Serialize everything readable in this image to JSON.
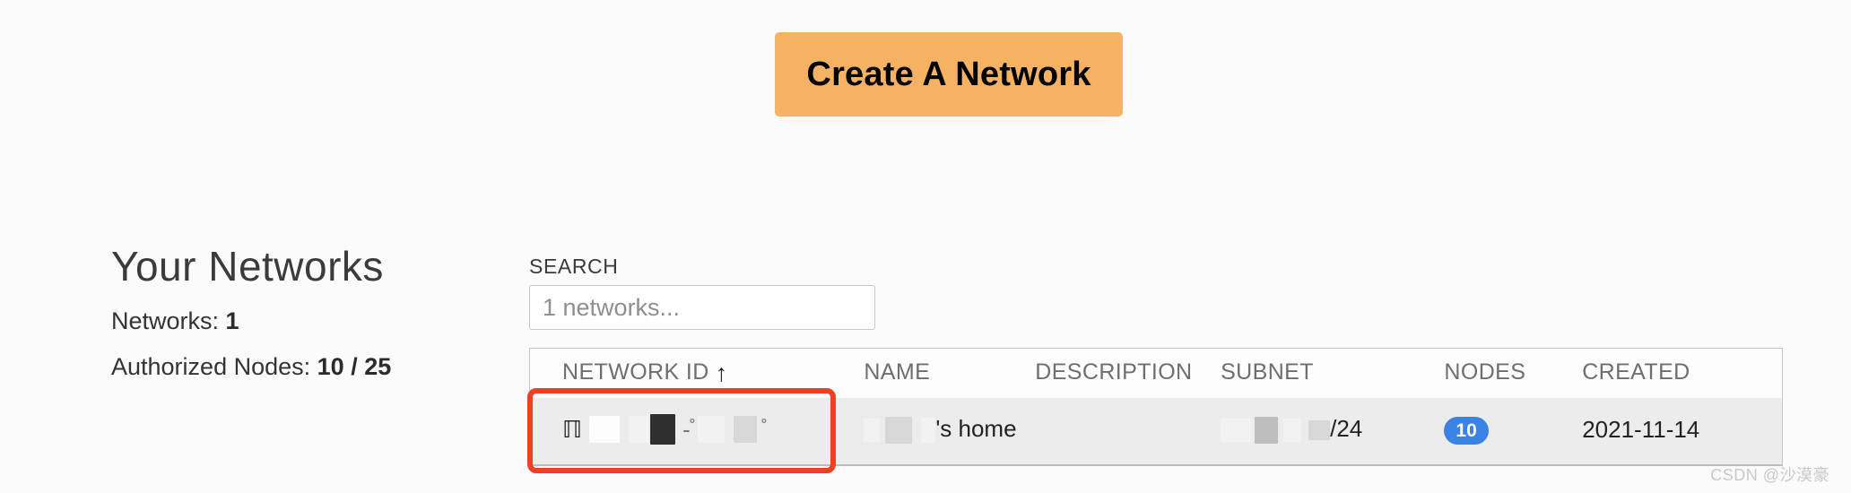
{
  "toolbar": {
    "create_network_label": "Create A Network",
    "accent_color": "#f5b263"
  },
  "sidebar": {
    "title": "Your Networks",
    "stats": [
      {
        "label": "Networks:",
        "value": "1"
      },
      {
        "label": "Authorized Nodes:",
        "value": "10 / 25"
      }
    ]
  },
  "search": {
    "label": "SEARCH",
    "placeholder": "1 networks...",
    "value": ""
  },
  "table": {
    "columns": [
      {
        "key": "network_id",
        "label": "NETWORK ID",
        "sort": "asc",
        "sort_glyph": "↑"
      },
      {
        "key": "name",
        "label": "NAME"
      },
      {
        "key": "description",
        "label": "DESCRIPTION"
      },
      {
        "key": "subnet",
        "label": "SUBNET"
      },
      {
        "key": "nodes",
        "label": "NODES"
      },
      {
        "key": "created",
        "label": "CREATED"
      }
    ],
    "rows": [
      {
        "network_id": "",
        "network_id_redacted": true,
        "name_suffix": "'s home",
        "name_redacted": true,
        "description": "",
        "subnet_suffix": "/24",
        "subnet_redacted": true,
        "nodes": "10",
        "nodes_badge_color": "#3a82e4",
        "created": "2021-11-14"
      }
    ]
  },
  "annotation": {
    "shape": "rectangle",
    "target": "network-id-cell",
    "color": "#ef4023"
  },
  "watermark": {
    "text": "CSDN @沙漠豪"
  }
}
